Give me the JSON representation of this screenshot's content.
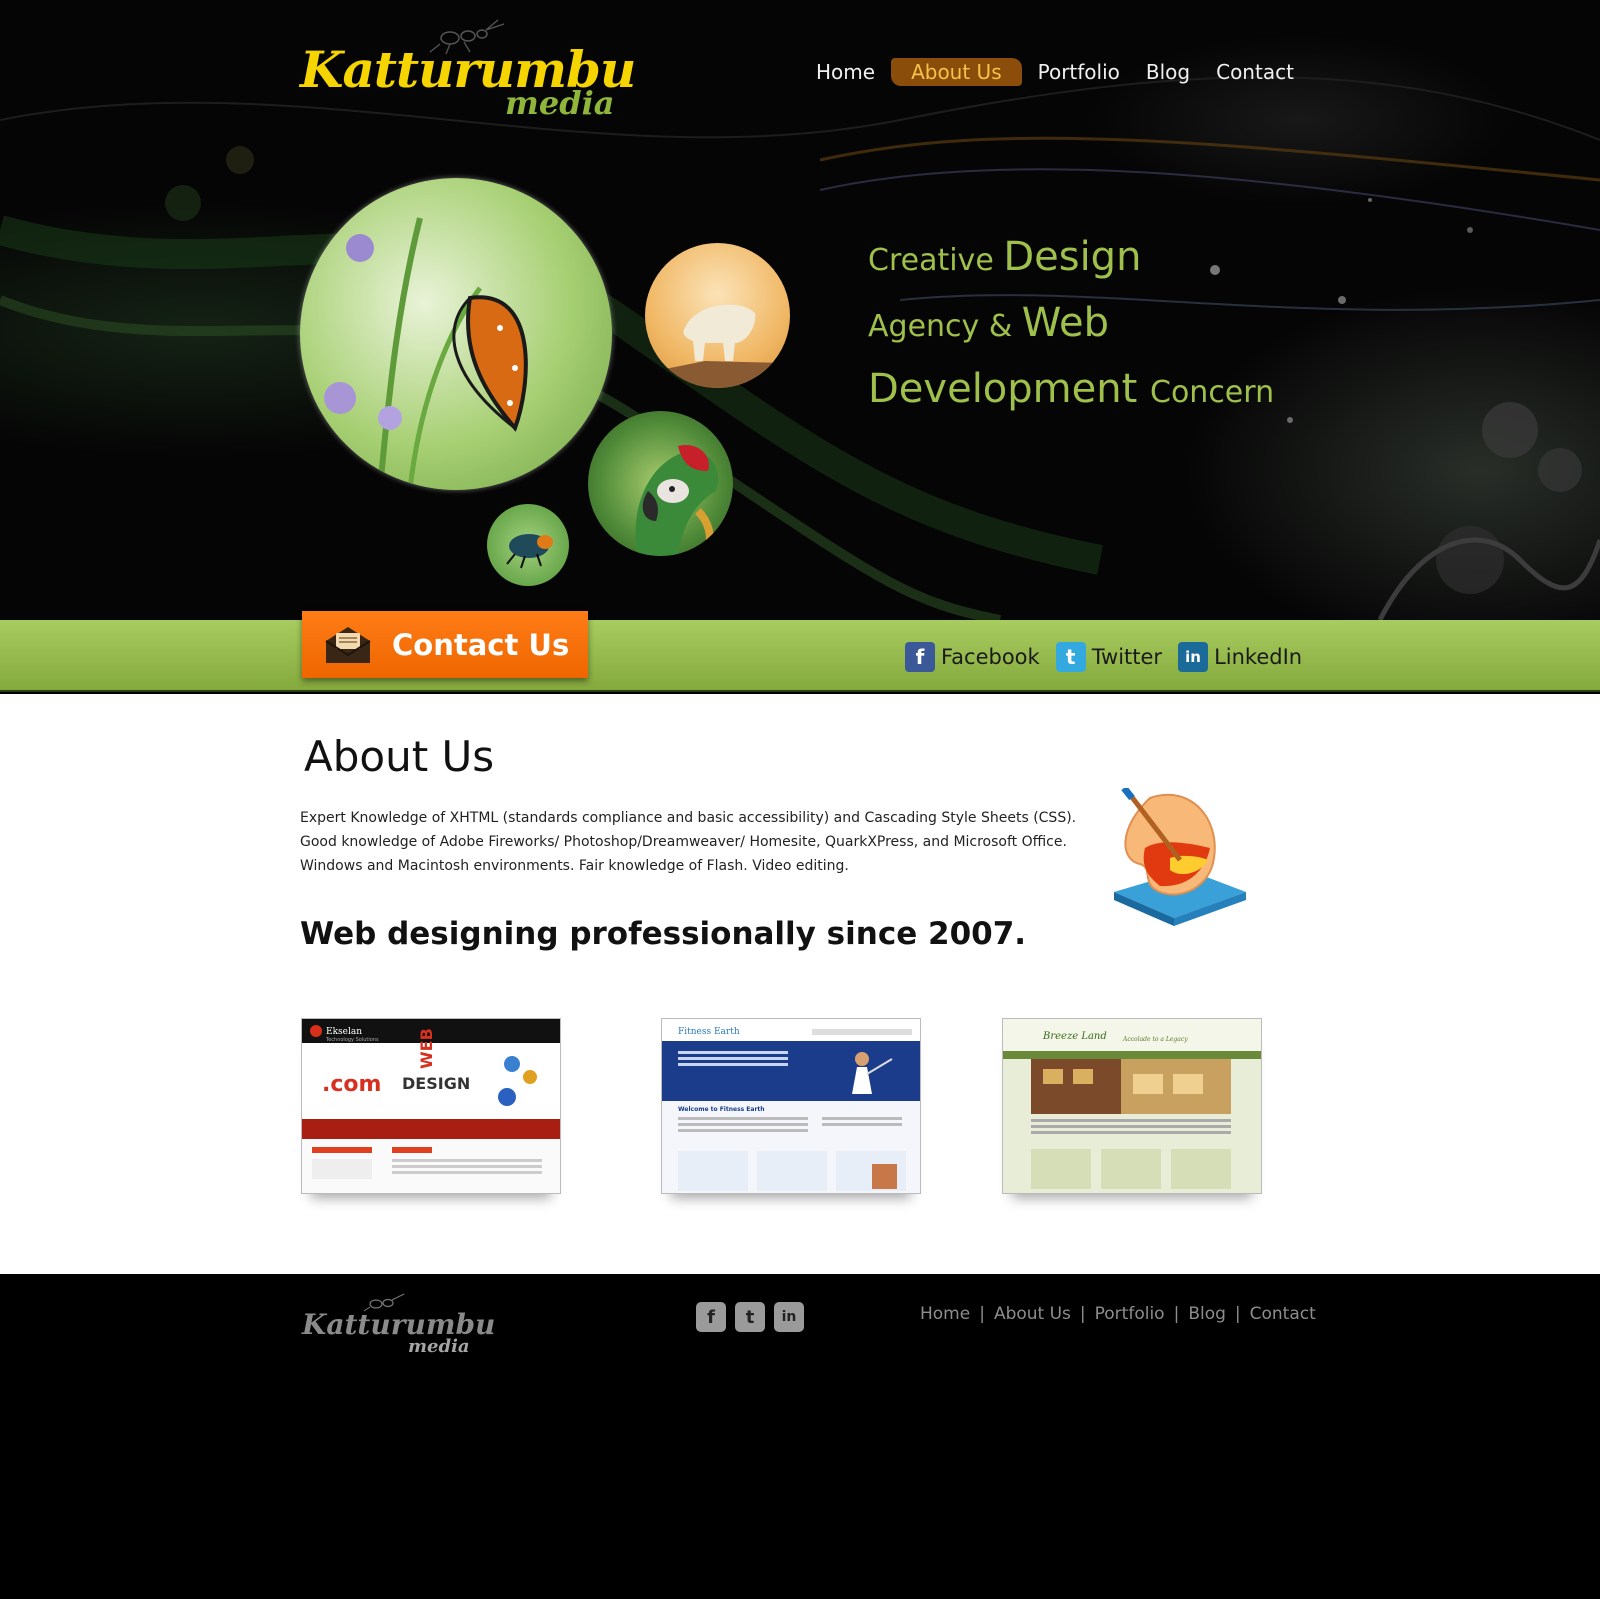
{
  "brand": {
    "name_main": "Katturumbu",
    "name_sub": "media",
    "primary_color": "#f5d400",
    "accent_color": "#8fb53a"
  },
  "nav": {
    "items": [
      {
        "label": "Home",
        "active": false
      },
      {
        "label": "About Us",
        "active": true
      },
      {
        "label": "Portfolio",
        "active": false
      },
      {
        "label": "Blog",
        "active": false
      },
      {
        "label": "Contact",
        "active": false
      }
    ]
  },
  "hero": {
    "tagline": [
      [
        {
          "text": "Creative ",
          "size": "sm"
        },
        {
          "text": "Design",
          "size": "lg"
        }
      ],
      [
        {
          "text": "Agency & ",
          "size": "sm"
        },
        {
          "text": "Web",
          "size": "lg"
        }
      ],
      [
        {
          "text": "Development ",
          "size": "lg"
        },
        {
          "text": "Concern",
          "size": "sm"
        }
      ]
    ],
    "images": [
      "butterfly",
      "mountain-goat",
      "parrot",
      "beetle"
    ]
  },
  "contact_button": {
    "label": "Contact Us",
    "icon": "envelope-icon",
    "color": "#ff7417"
  },
  "social": [
    {
      "label": "Facebook",
      "icon": "facebook-icon",
      "glyph": "f",
      "color": "#3b5998"
    },
    {
      "label": "Twitter",
      "icon": "twitter-icon",
      "glyph": "t",
      "color": "#33a9e0"
    },
    {
      "label": "LinkedIn",
      "icon": "linkedin-icon",
      "glyph": "in",
      "color": "#1a6a9a"
    }
  ],
  "about": {
    "title": "About Us",
    "body": "Expert Knowledge of XHTML (standards compliance and basic accessibility) and Cascading Style Sheets (CSS). Good knowledge of Adobe Fireworks/ Photoshop/Dreamweaver/ Homesite, QuarkXPress, and Microsoft Office. Windows and Macintosh environments. Fair knowledge of Flash. Video editing.",
    "since": "Web designing professionally since 2007."
  },
  "portfolio": [
    {
      "site": "Ekselan",
      "tagline": "Technology Solutions"
    },
    {
      "site": "Fitness Earth",
      "tagline": "Welcome to Fitness Earth"
    },
    {
      "site": "Breeze Land",
      "tagline": "Accolade to a Legacy"
    }
  ],
  "footer": {
    "nav": [
      "Home",
      "About Us",
      "Portfolio",
      "Blog",
      "Contact"
    ],
    "social_icons": [
      {
        "icon": "facebook-icon",
        "glyph": "f"
      },
      {
        "icon": "twitter-icon",
        "glyph": "t"
      },
      {
        "icon": "linkedin-icon",
        "glyph": "in"
      }
    ]
  }
}
